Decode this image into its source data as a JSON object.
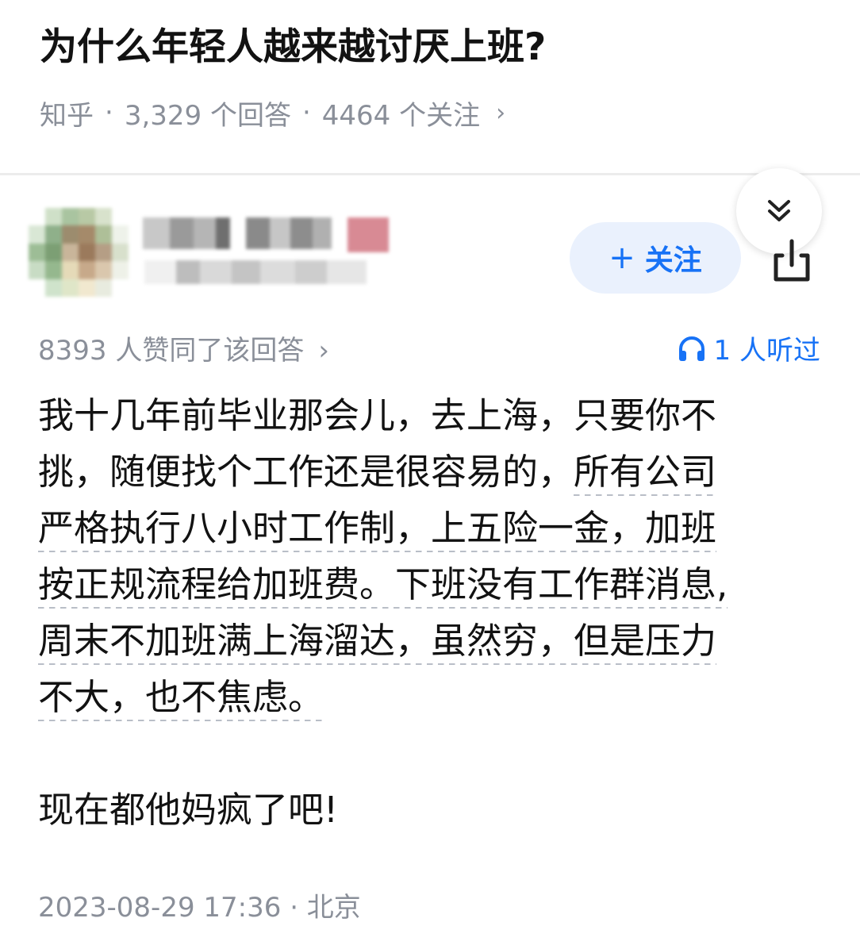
{
  "question": {
    "title": "为什么年轻人越来越讨厌上班?",
    "source": "知乎",
    "answer_count": "3,329 个回答",
    "follow_count": "4464 个关注",
    "separator": "·",
    "chevron": "›"
  },
  "answer": {
    "follow_button_label": "关注",
    "follow_plus": "+",
    "agree_text": "8393 人赞同了该回答",
    "listen_text": "1 人听过",
    "lines_plain": [
      "我十几年前毕业那会儿，去上海，只要你不",
      "挑，随便找个工作还是很容易的，"
    ],
    "lines_dashed_first": "所有公司",
    "lines_dashed": [
      "严格执行八小时工作制，上五险一金，加班",
      "按正规流程给加班费。下班没有工作群消息,",
      "周末不加班满上海溜达，虽然穷，但是压力",
      "不大，也不焦虑。"
    ],
    "closing": "现在都他妈疯了吧!",
    "timestamp": "2023-08-29 17:36 · 北京"
  },
  "icons": {
    "collapse": "double-chevron-down-icon",
    "share": "share-icon",
    "headphones": "headphones-icon"
  },
  "colors": {
    "accent": "#1772f6",
    "follow_bg": "#eaf1fd",
    "meta_text": "#8a8f99"
  }
}
